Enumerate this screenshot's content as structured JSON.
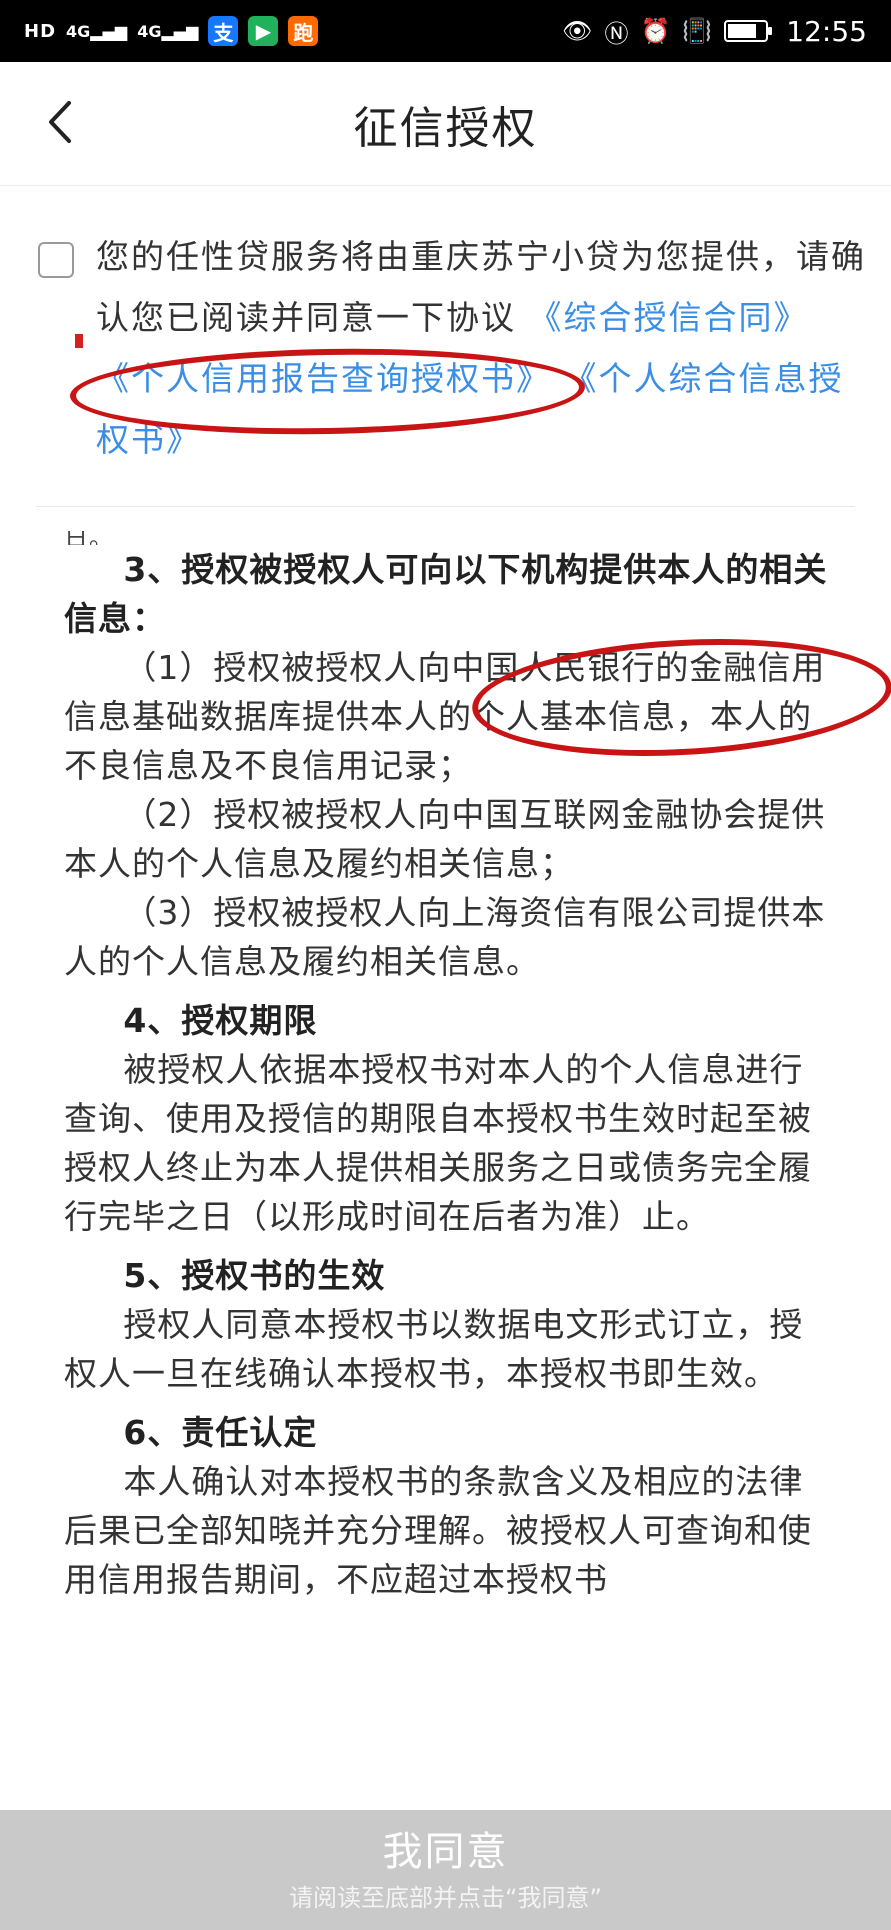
{
  "status_bar": {
    "network_label": "HD",
    "signal1": "4G",
    "signal2": "4G",
    "apps": [
      "支",
      "▶",
      "跑"
    ],
    "time": "12:55"
  },
  "nav": {
    "title": "征信授权"
  },
  "agreement": {
    "text_prefix": "您的任性贷服务将由重庆苏宁小贷为您提供，请确认您已阅读并同意一下协议",
    "link1": "《综合授信合同》",
    "link2": "《个人信用报告查询授权书》",
    "link3": "《个人综合信息授权书》"
  },
  "document": {
    "clipped_text": "日。",
    "sec3_title": "3、授权被授权人可向以下机构提供本人的相关信息：",
    "sec3_p1": "（1）授权被授权人向中国人民银行的金融信用信息基础数据库提供本人的个人基本信息，本人的不良信息及不良信用记录；",
    "sec3_p2": "（2）授权被授权人向中国互联网金融协会提供本人的个人信息及履约相关信息；",
    "sec3_p3": "（3）授权被授权人向上海资信有限公司提供本人的个人信息及履约相关信息。",
    "sec4_title": "4、授权期限",
    "sec4_p1": "被授权人依据本授权书对本人的个人信息进行查询、使用及授信的期限自本授权书生效时起至被授权人终止为本人提供相关服务之日或债务完全履行完毕之日（以形成时间在后者为准）止。",
    "sec5_title": "5、授权书的生效",
    "sec5_p1": "授权人同意本授权书以数据电文形式订立，授权人一旦在线确认本授权书，本授权书即生效。",
    "sec6_title": "6、责任认定",
    "sec6_p1": "本人确认对本授权书的条款含义及相应的法律后果已全部知晓并充分理解。被授权人可查询和使用信用报告期间，不应超过本授权书"
  },
  "bottom_bar": {
    "button_label": "我同意",
    "hint": "请阅读至底部并点击“我同意”"
  },
  "colors": {
    "link": "#3a8ee6",
    "annotation": "#c81414",
    "bottom_bar": "#c9c9c9"
  }
}
